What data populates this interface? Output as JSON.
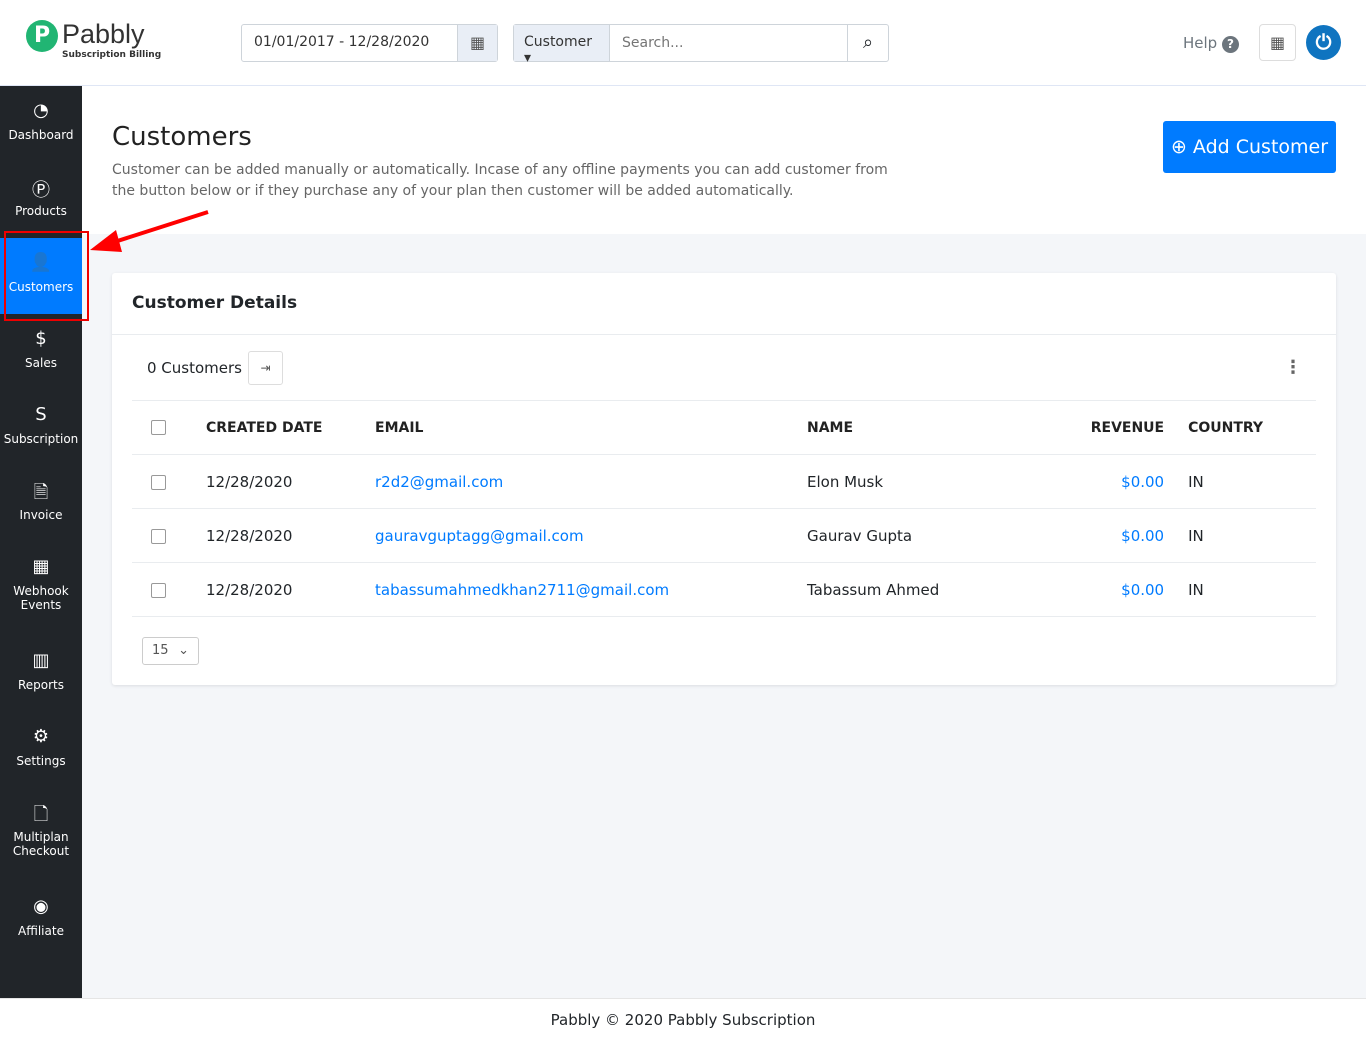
{
  "header": {
    "brand": "Pabbly",
    "brand_sub": "Subscription Billing",
    "date_range": "01/01/2017 - 12/28/2020",
    "search_filter": "Customer",
    "search_placeholder": "Search...",
    "help": "Help"
  },
  "sidebar": {
    "items": [
      {
        "label": "Dashboard",
        "icon": "◔"
      },
      {
        "label": "Products",
        "icon": "Ⓟ"
      },
      {
        "label": "Customers",
        "icon": "👤"
      },
      {
        "label": "Sales",
        "icon": "$"
      },
      {
        "label": "Subscription",
        "icon": "S"
      },
      {
        "label": "Invoice",
        "icon": "🗎"
      },
      {
        "label": "Webhook Events",
        "icon": "▦"
      },
      {
        "label": "Reports",
        "icon": "▥"
      },
      {
        "label": "Settings",
        "icon": "⚙"
      },
      {
        "label": "Multiplan Checkout",
        "icon": "🗋"
      },
      {
        "label": "Affiliate",
        "icon": "◉"
      }
    ]
  },
  "page": {
    "title": "Customers",
    "description": "Customer can be added manually or automatically. Incase of any offline payments you can add customer from the button below or if they purchase any of your plan then customer will be added automatically.",
    "add_button": "Add Customer"
  },
  "card": {
    "title": "Customer Details",
    "count": "0 Customers",
    "columns": [
      "CREATED DATE",
      "EMAIL",
      "NAME",
      "REVENUE",
      "COUNTRY"
    ],
    "rows": [
      {
        "date": "12/28/2020",
        "email": "r2d2@gmail.com",
        "name": "Elon Musk",
        "revenue": "$0.00",
        "country": "IN"
      },
      {
        "date": "12/28/2020",
        "email": "gauravguptagg@gmail.com",
        "name": "Gaurav Gupta",
        "revenue": "$0.00",
        "country": "IN"
      },
      {
        "date": "12/28/2020",
        "email": "tabassumahmedkhan2711@gmail.com",
        "name": "Tabassum Ahmed",
        "revenue": "$0.00",
        "country": "IN"
      }
    ],
    "per_page": "15"
  },
  "footer": "Pabbly © 2020 Pabbly Subscription",
  "colors": {
    "primary": "#007bff",
    "sidebar": "#212529",
    "logo": "#21b573"
  }
}
